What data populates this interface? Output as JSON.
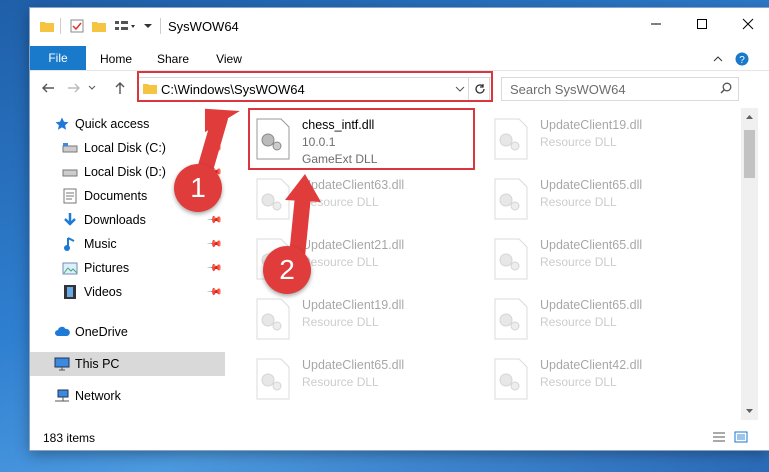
{
  "window": {
    "title": "SysWOW64",
    "minimize_icon": "minimize-icon",
    "maximize_icon": "maximize-icon",
    "close_icon": "close-icon"
  },
  "ribbon": {
    "tabs": [
      {
        "label": "File"
      },
      {
        "label": "Home"
      },
      {
        "label": "Share"
      },
      {
        "label": "View"
      }
    ]
  },
  "address": {
    "path": "C:\\Windows\\SysWOW64",
    "search_placeholder": "Search SysWOW64"
  },
  "sidebar": {
    "items": [
      {
        "label": "Quick access",
        "icon": "star-icon"
      },
      {
        "label": "Local Disk (C:)",
        "icon": "drive-icon"
      },
      {
        "label": "Local Disk (D:)",
        "icon": "drive-icon"
      },
      {
        "label": "Documents",
        "icon": "documents-icon"
      },
      {
        "label": "Downloads",
        "icon": "download-icon"
      },
      {
        "label": "Music",
        "icon": "music-icon"
      },
      {
        "label": "Pictures",
        "icon": "pictures-icon"
      },
      {
        "label": "Videos",
        "icon": "videos-icon"
      },
      {
        "label": "OneDrive",
        "icon": "cloud-icon"
      },
      {
        "label": "This PC",
        "icon": "computer-icon"
      },
      {
        "label": "Network",
        "icon": "network-icon"
      }
    ]
  },
  "files": [
    {
      "name": "chess_intf.dll",
      "version": "10.0.1",
      "desc": "GameExt DLL"
    },
    {
      "name": "UpdateClient19.dll",
      "desc": "Resource DLL"
    },
    {
      "name": "UpdateClient63.dll",
      "desc": "Resource DLL"
    },
    {
      "name": "UpdateClient65.dll",
      "desc": "Resource DLL"
    },
    {
      "name": "UpdateClient21.dll",
      "desc": "Resource DLL"
    },
    {
      "name": "UpdateClient65.dll",
      "desc": "Resource DLL"
    },
    {
      "name": "UpdateClient19.dll",
      "desc": "Resource DLL"
    },
    {
      "name": "UpdateClient65.dll",
      "desc": "Resource DLL"
    },
    {
      "name": "UpdateClient65.dll",
      "desc": "Resource DLL"
    },
    {
      "name": "UpdateClient42.dll",
      "desc": "Resource DLL"
    }
  ],
  "status": {
    "item_count": "183 items"
  },
  "annotations": {
    "marker1": "1",
    "marker2": "2",
    "highlight_color": "#d9363e"
  }
}
